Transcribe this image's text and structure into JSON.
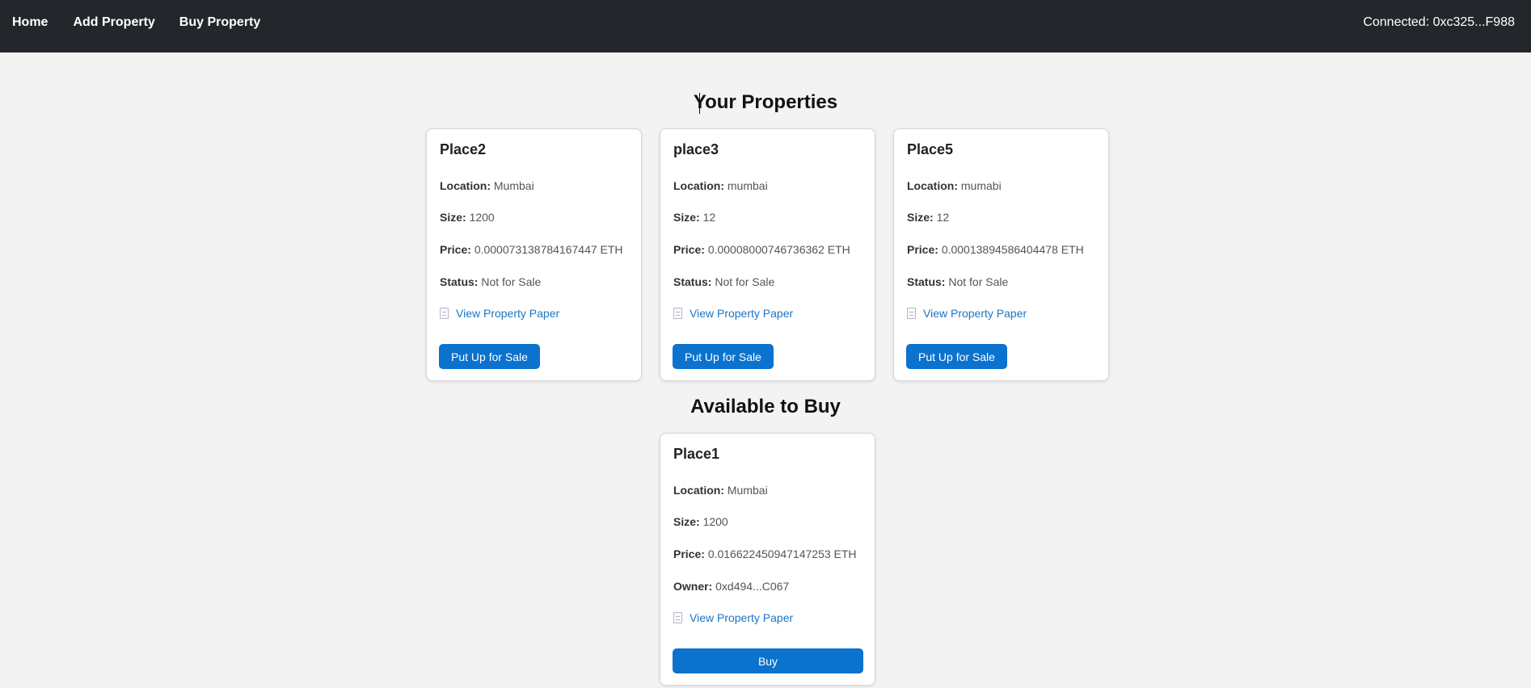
{
  "nav": {
    "home": "Home",
    "add_property": "Add Property",
    "buy_property": "Buy Property",
    "connected": "Connected: 0xc325...F988"
  },
  "your_properties": {
    "title": "Your Properties",
    "cards": [
      {
        "name": "Place2",
        "location_label": "Location:",
        "location": "Mumbai",
        "size_label": "Size:",
        "size": "1200",
        "price_label": "Price:",
        "price": "0.000073138784167447 ETH",
        "status_label": "Status:",
        "status": "Not for Sale",
        "paper_link": "View Property Paper",
        "action": "Put Up for Sale"
      },
      {
        "name": "place3",
        "location_label": "Location:",
        "location": "mumbai",
        "size_label": "Size:",
        "size": "12",
        "price_label": "Price:",
        "price": "0.00008000746736362 ETH",
        "status_label": "Status:",
        "status": "Not for Sale",
        "paper_link": "View Property Paper",
        "action": "Put Up for Sale"
      },
      {
        "name": "Place5",
        "location_label": "Location:",
        "location": "mumabi",
        "size_label": "Size:",
        "size": "12",
        "price_label": "Price:",
        "price": "0.00013894586404478 ETH",
        "status_label": "Status:",
        "status": "Not for Sale",
        "paper_link": "View Property Paper",
        "action": "Put Up for Sale"
      }
    ]
  },
  "available": {
    "title": "Available to Buy",
    "cards": [
      {
        "name": "Place1",
        "location_label": "Location:",
        "location": "Mumbai",
        "size_label": "Size:",
        "size": "1200",
        "price_label": "Price:",
        "price": "0.016622450947147253 ETH",
        "owner_label": "Owner:",
        "owner": "0xd494...C067",
        "paper_link": "View Property Paper",
        "action": "Buy"
      }
    ]
  },
  "icons": {
    "paper": "document-icon"
  },
  "colors": {
    "navbar": "#23272b",
    "background": "#f3f3f3",
    "button": "#0b72ce",
    "link": "#1c74c4"
  }
}
